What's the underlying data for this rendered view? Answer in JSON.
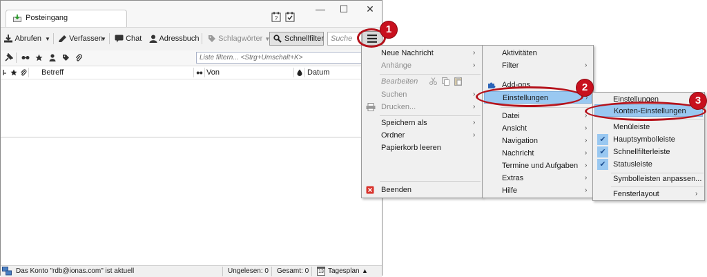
{
  "window": {
    "tab_label": "Posteingang",
    "minimize_glyph": "—",
    "maximize_glyph": "☐",
    "close_glyph": "✕"
  },
  "toolbar": {
    "abrufen": "Abrufen",
    "verfassen": "Verfassen",
    "chat": "Chat",
    "adressbuch": "Adressbuch",
    "schlagwoerter": "Schlagwörter",
    "schnellfilter": "Schnellfilter",
    "search_placeholder": "Suche"
  },
  "filterbar": {
    "placeholder": "Liste filtern... <Strg+Umschalt+K>"
  },
  "columns": {
    "betreff": "Betreff",
    "von": "Von",
    "datum": "Datum"
  },
  "status": {
    "account": "Das Konto \"rdb@ionas.com\" ist aktuell",
    "unread": "Ungelesen: 0",
    "total": "Gesamt: 0",
    "calendar_day": "13",
    "tagesplan": "Tagesplan"
  },
  "menu1": {
    "neue_nachricht": "Neue Nachricht",
    "anhaenge": "Anhänge",
    "bearbeiten": "Bearbeiten",
    "suchen": "Suchen",
    "drucken": "Drucken...",
    "speichern_als": "Speichern als",
    "ordner": "Ordner",
    "papierkorb": "Papierkorb leeren",
    "beenden": "Beenden"
  },
  "menu2": {
    "aktivitaeten": "Aktivitäten",
    "filter": "Filter",
    "addons": "Add-ons",
    "einstellungen": "Einstellungen",
    "datei": "Datei",
    "ansicht": "Ansicht",
    "navigation": "Navigation",
    "nachricht": "Nachricht",
    "termine": "Termine und Aufgaben",
    "extras": "Extras",
    "hilfe": "Hilfe"
  },
  "menu3": {
    "einstellungen": "Einstellungen",
    "konten": "Konten-Einstellungen",
    "menueleiste": "Menüleiste",
    "hauptsymbolleiste": "Hauptsymbolleiste",
    "schnellfilterleiste": "Schnellfilterleiste",
    "statusleiste": "Statusleiste",
    "symbolleisten": "Symbolleisten anpassen...",
    "fensterlayout": "Fensterlayout"
  },
  "annotations": [
    "1",
    "2",
    "3"
  ],
  "colors": {
    "highlight": "#99c8f1",
    "annotation_red": "#c8101e"
  }
}
